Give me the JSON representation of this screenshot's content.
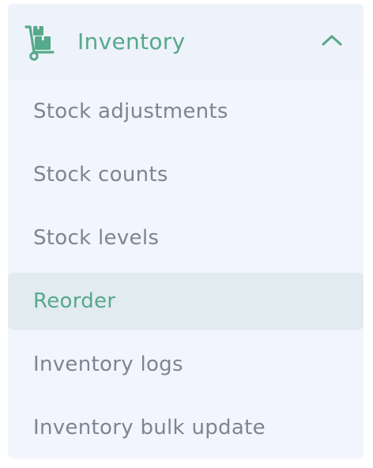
{
  "menu": {
    "title": "Inventory",
    "header_icon": "hand-truck-icon",
    "toggle_icon": "chevron-up-icon",
    "accent_color": "#56a98a",
    "items": [
      {
        "label": "Stock adjustments",
        "active": false
      },
      {
        "label": "Stock counts",
        "active": false
      },
      {
        "label": "Stock levels",
        "active": false
      },
      {
        "label": "Reorder",
        "active": true
      },
      {
        "label": "Inventory logs",
        "active": false
      },
      {
        "label": "Inventory bulk update",
        "active": false
      }
    ]
  }
}
